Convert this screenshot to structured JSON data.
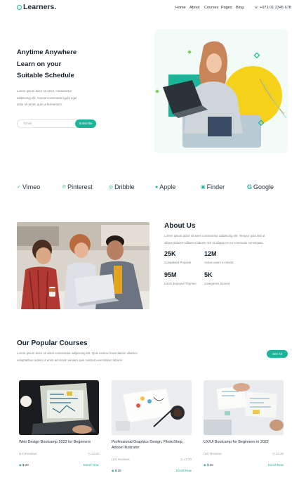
{
  "nav": {
    "logo": "Learners.",
    "links": [
      "Home",
      "About",
      "Courses",
      "Pages",
      "Blog"
    ],
    "phone": "+971 01 2345 678"
  },
  "hero": {
    "title_lines": [
      "Anytime Anywhere",
      "Learn on your",
      "Suitable Schedule"
    ],
    "text_lines": [
      "Lorem ipsum dolor sit amet, consectetur",
      "adipiscing elit. Aenean commodo ligula eget",
      "dolor sit amet, quis ut fermentum."
    ],
    "email_placeholder": "Email",
    "subscribe_label": "Subscribe"
  },
  "brands": [
    "Vimeo",
    "Pinterest",
    "Dribble",
    "Apple",
    "Finder",
    "Google"
  ],
  "about": {
    "title": "About Us",
    "text_lines": [
      "Lorem ipsum dolor sit amet consectetur adipiscing elit. Tempor quis nisl ut",
      "aliqua dolorem ullamco laboris nisi ut aliquip ex ea commodo consequat."
    ],
    "stats": [
      {
        "value": "25K",
        "label": "Completed Projects"
      },
      {
        "value": "12M",
        "label": "Active users In World"
      },
      {
        "value": "95M",
        "label": "Users Enjoyed Themes"
      },
      {
        "value": "5K",
        "label": "Categories Served"
      }
    ]
  },
  "courses": {
    "title": "Our Popular Courses",
    "text_lines": [
      "Lorem ipsum dolor sit amet consectetur adipiscing elit. Quis nostrud exercitation ullamco",
      "voluptatibus autem ut enim ad minim veniam quis nostrud exercitation laboris."
    ],
    "see_all": "See All",
    "items": [
      {
        "title": "Web Design Bootcamp 2022 for Beginners",
        "reviews": "(14) Reviews",
        "duration": "12:20",
        "price": "$ 20",
        "action": "Enroll Now"
      },
      {
        "title": "Professional Graphics Design, PhotoShop, Adobe Illustrator",
        "reviews": "(12) Reviews",
        "duration": "12:20",
        "price": "$ 26",
        "action": "Enroll Now"
      },
      {
        "title": "UX/UI Bootcamp for Beginners in 2022",
        "reviews": "(14) Reviews",
        "duration": "12:20",
        "price": "$ 26",
        "action": "Enroll Now"
      }
    ]
  },
  "colors": {
    "accent": "#1bb59a",
    "yellow": "#f6d11a",
    "hero_bg": "#f3fbf8"
  }
}
